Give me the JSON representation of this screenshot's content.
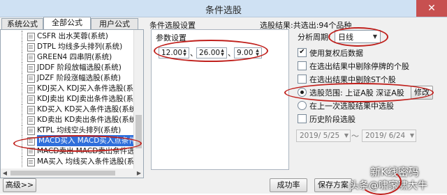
{
  "window": {
    "title": "条件选股",
    "close_glyph": "✕"
  },
  "tabs": [
    {
      "label": "系统公式"
    },
    {
      "label": "全部公式"
    },
    {
      "label": "用户公式"
    }
  ],
  "tree": {
    "items": [
      {
        "label": "CSFR 出水芙蓉(系统)"
      },
      {
        "label": "DTPL 均线多头排列(系统)"
      },
      {
        "label": "GREEN4 四串阴(系统)"
      },
      {
        "label": "JDDF 阶段放幅选股(系统)"
      },
      {
        "label": "JDZF 阶段涨幅选股(系统)"
      },
      {
        "label": "KDJ买入 KDJ买入条件选股(系统)"
      },
      {
        "label": "KDJ卖出 KDJ卖出条件选股(系统)"
      },
      {
        "label": "KD买入 KD买入条件选股(系统)"
      },
      {
        "label": "KD卖出 KD卖出条件选股(系统)"
      },
      {
        "label": "KTPL 均线空头排列(系统)"
      },
      {
        "label": "MACD买入 MACD买入点条件选"
      },
      {
        "label": "MACD卖出 MACD卖出条件选股(系统)"
      },
      {
        "label": "MA买入 均线买入条件选股(系统)"
      }
    ]
  },
  "buttons": {
    "advanced": "高级>>",
    "success_rate": "成功率",
    "save_plan": "保存方案",
    "edit": "修改"
  },
  "header": {
    "section_title": "条件选股设置",
    "result": "选股结果:共选出:94个品种"
  },
  "params": {
    "title": "参数设置",
    "p1": "12.00",
    "p2": "26.00",
    "p3": "9.00",
    "sep": "、"
  },
  "period": {
    "label": "分析周期:",
    "value": "日线"
  },
  "options": {
    "use_adjusted": "使用复权后数据",
    "remove_suspended": "在选出结果中剔除停牌的个股",
    "remove_st": "在选出结果中剔除ST个股",
    "scope": "选股范围: 上证A股 深证A股",
    "last_result": "在上一次选股结果中选股",
    "history_stage": "历史阶段选股"
  },
  "dates": {
    "from": "2019/ 5/25",
    "to": "2019/ 6/24",
    "dash": "～"
  },
  "watermark": {
    "line1": "新K线密码",
    "line2": "头条@啸家啸大牛"
  }
}
